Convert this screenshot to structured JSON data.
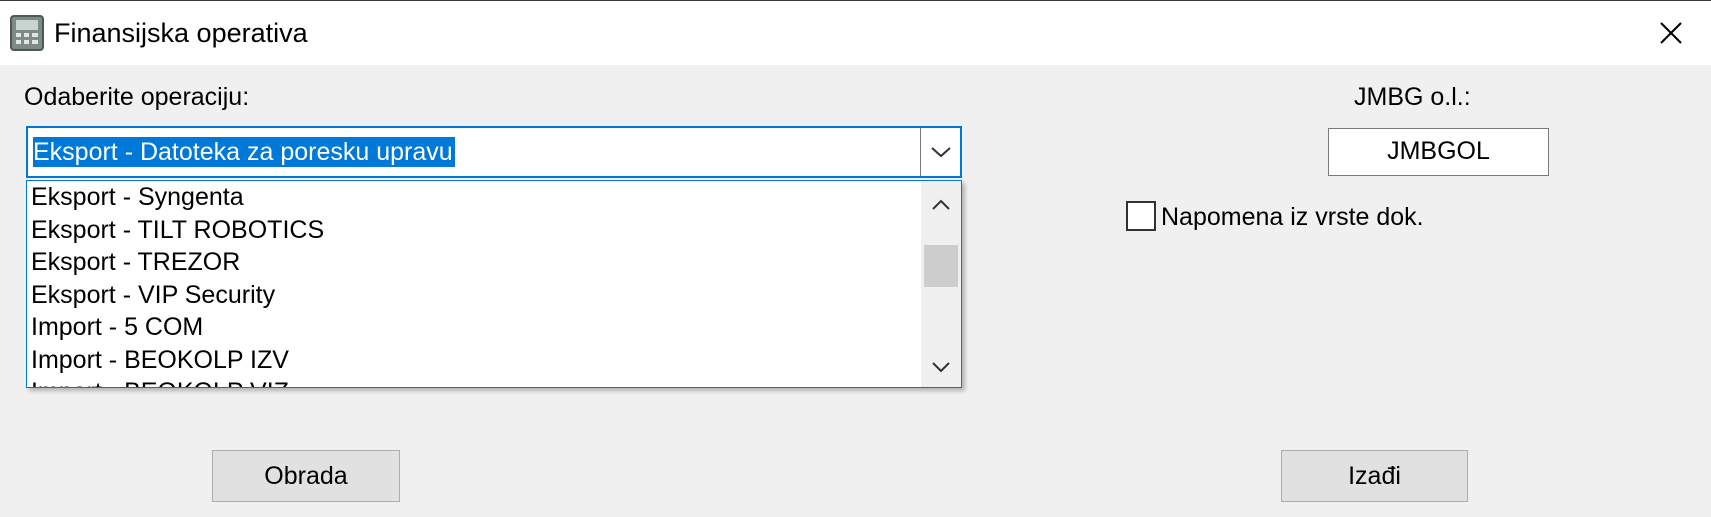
{
  "window": {
    "title": "Finansijska operativa",
    "app_icon": "calculator-icon",
    "close_icon": "close-icon"
  },
  "operation": {
    "label": "Odaberite operaciju:",
    "selected": "Eksport - Datoteka za poresku upravu",
    "options": [
      "Eksport - Syngenta",
      "Eksport - TILT ROBOTICS",
      "Eksport - TREZOR",
      "Eksport - VIP Security",
      "Import - 5 COM",
      "Import - BEOKOLP IZV",
      "Import - BEOKOLP VIZ"
    ]
  },
  "jmbg": {
    "label": "JMBG o.l.:",
    "value": "JMBGOL"
  },
  "napomena": {
    "label": "Napomena iz vrste dok.",
    "checked": false
  },
  "buttons": {
    "process": "Obrada",
    "exit": "Izađi"
  },
  "colors": {
    "accent": "#0078d7",
    "background": "#f0f0f0"
  }
}
